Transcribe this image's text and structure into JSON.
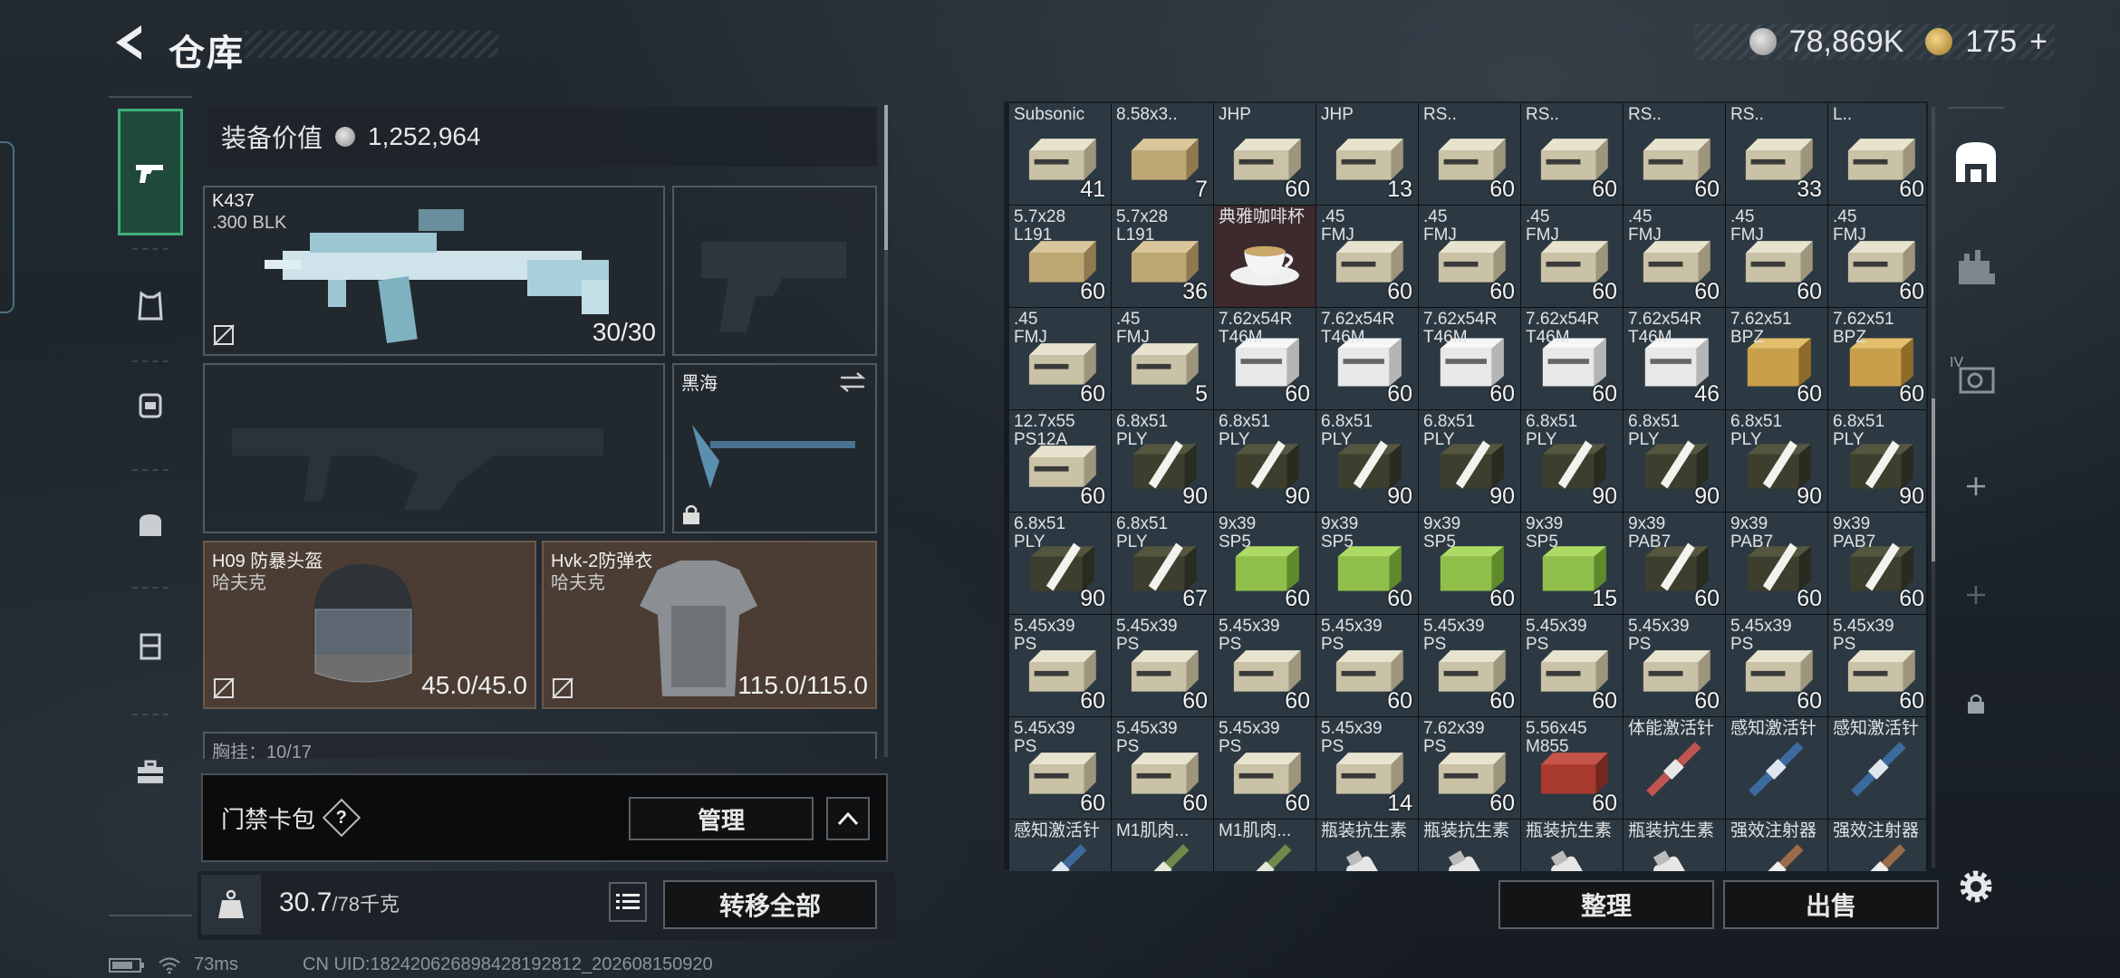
{
  "header": {
    "title": "仓库"
  },
  "currency": {
    "silver": "78,869K",
    "gold": "175",
    "gold_plus": "+"
  },
  "equip_value": {
    "label": "装备价值",
    "value": "1,252,964"
  },
  "sidebar": {
    "items": [
      "pistol-icon",
      "armor-vest-icon",
      "backpack-icon",
      "chest-rig-icon",
      "case-icon",
      "toolbox-icon"
    ]
  },
  "slots": {
    "primary": {
      "name": "K437",
      "sub": ".300 BLK",
      "ammo": "30/30"
    },
    "melee": {
      "name": "黑海"
    },
    "helmet": {
      "name": "H09 防暴头盔",
      "sub": "哈夫克",
      "dur": "45.0/45.0"
    },
    "armor": {
      "name": "Hvk-2防弹衣",
      "sub": "哈夫克",
      "dur": "115.0/115.0"
    },
    "chest_partial": "胸挂：10/17"
  },
  "card": {
    "label": "门禁卡包",
    "help": "?",
    "manage": "管理"
  },
  "weight": {
    "current": "30.7",
    "max": "/78千克"
  },
  "transfer_all": "转移全部",
  "status": {
    "ping": "73ms",
    "uid": "CN UID:18242062689842819281​2_202608150920"
  },
  "buttons": {
    "sort": "整理",
    "sell": "出售"
  },
  "grid": [
    {
      "l1": "Subsonic",
      "l2": "",
      "count": "41",
      "art": "ammo-box"
    },
    {
      "l1": "8.58x3..",
      "l2": "",
      "count": "7",
      "art": "ammo-tan"
    },
    {
      "l1": "JHP",
      "l2": "",
      "count": "60",
      "art": "ammo-box"
    },
    {
      "l1": "JHP",
      "l2": "",
      "count": "13",
      "art": "ammo-box"
    },
    {
      "l1": "RS..",
      "l2": "",
      "count": "60",
      "art": "ammo-box"
    },
    {
      "l1": "RS..",
      "l2": "",
      "count": "60",
      "art": "ammo-box"
    },
    {
      "l1": "RS..",
      "l2": "",
      "count": "60",
      "art": "ammo-box"
    },
    {
      "l1": "RS..",
      "l2": "",
      "count": "33",
      "art": "ammo-box"
    },
    {
      "l1": "L..",
      "l2": "",
      "count": "60",
      "art": "ammo-box"
    },
    {
      "l1": "5.7x28",
      "l2": "L191",
      "count": "60",
      "art": "ammo-tan"
    },
    {
      "l1": "5.7x28",
      "l2": "L191",
      "count": "36",
      "art": "ammo-tan"
    },
    {
      "l1": "典雅咖啡杯",
      "l2": "",
      "count": "",
      "art": "teacup",
      "red": true
    },
    {
      "l1": ".45",
      "l2": "FMJ",
      "count": "60",
      "art": "ammo-box"
    },
    {
      "l1": ".45",
      "l2": "FMJ",
      "count": "60",
      "art": "ammo-box"
    },
    {
      "l1": ".45",
      "l2": "FMJ",
      "count": "60",
      "art": "ammo-box"
    },
    {
      "l1": ".45",
      "l2": "FMJ",
      "count": "60",
      "art": "ammo-box"
    },
    {
      "l1": ".45",
      "l2": "FMJ",
      "count": "60",
      "art": "ammo-box"
    },
    {
      "l1": ".45",
      "l2": "FMJ",
      "count": "60",
      "art": "ammo-box"
    },
    {
      "l1": ".45",
      "l2": "FMJ",
      "count": "60",
      "art": "ammo-box"
    },
    {
      "l1": ".45",
      "l2": "FMJ",
      "count": "5",
      "art": "ammo-box"
    },
    {
      "l1": "7.62x54R",
      "l2": "T46M",
      "count": "60",
      "art": "ammo-white"
    },
    {
      "l1": "7.62x54R",
      "l2": "T46M",
      "count": "60",
      "art": "ammo-white"
    },
    {
      "l1": "7.62x54R",
      "l2": "T46M",
      "count": "60",
      "art": "ammo-white"
    },
    {
      "l1": "7.62x54R",
      "l2": "T46M",
      "count": "60",
      "art": "ammo-white"
    },
    {
      "l1": "7.62x54R",
      "l2": "T46M",
      "count": "46",
      "art": "ammo-white"
    },
    {
      "l1": "7.62x51",
      "l2": "BPZ",
      "count": "60",
      "art": "ammo-gold"
    },
    {
      "l1": "7.62x51",
      "l2": "BPZ",
      "count": "60",
      "art": "ammo-gold"
    },
    {
      "l1": "12.7x55",
      "l2": "PS12A",
      "count": "60",
      "art": "ammo-box"
    },
    {
      "l1": "6.8x51",
      "l2": "PLY",
      "count": "90",
      "art": "ammo-dark"
    },
    {
      "l1": "6.8x51",
      "l2": "PLY",
      "count": "90",
      "art": "ammo-dark"
    },
    {
      "l1": "6.8x51",
      "l2": "PLY",
      "count": "90",
      "art": "ammo-dark"
    },
    {
      "l1": "6.8x51",
      "l2": "PLY",
      "count": "90",
      "art": "ammo-dark"
    },
    {
      "l1": "6.8x51",
      "l2": "PLY",
      "count": "90",
      "art": "ammo-dark"
    },
    {
      "l1": "6.8x51",
      "l2": "PLY",
      "count": "90",
      "art": "ammo-dark"
    },
    {
      "l1": "6.8x51",
      "l2": "PLY",
      "count": "90",
      "art": "ammo-dark"
    },
    {
      "l1": "6.8x51",
      "l2": "PLY",
      "count": "90",
      "art": "ammo-dark"
    },
    {
      "l1": "6.8x51",
      "l2": "PLY",
      "count": "90",
      "art": "ammo-dark"
    },
    {
      "l1": "6.8x51",
      "l2": "PLY",
      "count": "67",
      "art": "ammo-dark"
    },
    {
      "l1": "9x39",
      "l2": "SP5",
      "count": "60",
      "art": "ammo-green"
    },
    {
      "l1": "9x39",
      "l2": "SP5",
      "count": "60",
      "art": "ammo-green"
    },
    {
      "l1": "9x39",
      "l2": "SP5",
      "count": "60",
      "art": "ammo-green"
    },
    {
      "l1": "9x39",
      "l2": "SP5",
      "count": "15",
      "art": "ammo-green"
    },
    {
      "l1": "9x39",
      "l2": "PAB7",
      "count": "60",
      "art": "ammo-dark"
    },
    {
      "l1": "9x39",
      "l2": "PAB7",
      "count": "60",
      "art": "ammo-dark"
    },
    {
      "l1": "9x39",
      "l2": "PAB7",
      "count": "60",
      "art": "ammo-dark"
    },
    {
      "l1": "5.45x39",
      "l2": "PS",
      "count": "60",
      "art": "ammo-box"
    },
    {
      "l1": "5.45x39",
      "l2": "PS",
      "count": "60",
      "art": "ammo-box"
    },
    {
      "l1": "5.45x39",
      "l2": "PS",
      "count": "60",
      "art": "ammo-box"
    },
    {
      "l1": "5.45x39",
      "l2": "PS",
      "count": "60",
      "art": "ammo-box"
    },
    {
      "l1": "5.45x39",
      "l2": "PS",
      "count": "60",
      "art": "ammo-box"
    },
    {
      "l1": "5.45x39",
      "l2": "PS",
      "count": "60",
      "art": "ammo-box"
    },
    {
      "l1": "5.45x39",
      "l2": "PS",
      "count": "60",
      "art": "ammo-box"
    },
    {
      "l1": "5.45x39",
      "l2": "PS",
      "count": "60",
      "art": "ammo-box"
    },
    {
      "l1": "5.45x39",
      "l2": "PS",
      "count": "60",
      "art": "ammo-box"
    },
    {
      "l1": "5.45x39",
      "l2": "PS",
      "count": "60",
      "art": "ammo-box"
    },
    {
      "l1": "5.45x39",
      "l2": "PS",
      "count": "60",
      "art": "ammo-box"
    },
    {
      "l1": "5.45x39",
      "l2": "PS",
      "count": "60",
      "art": "ammo-box"
    },
    {
      "l1": "5.45x39",
      "l2": "PS",
      "count": "14",
      "art": "ammo-box"
    },
    {
      "l1": "7.62x39",
      "l2": "PS",
      "count": "60",
      "art": "ammo-box"
    },
    {
      "l1": "5.56x45",
      "l2": "M855",
      "count": "60",
      "art": "ammo-red"
    },
    {
      "l1": "体能激活针",
      "l2": "",
      "count": "",
      "art": "syringe-red"
    },
    {
      "l1": "感知激活针",
      "l2": "",
      "count": "",
      "art": "syringe-blue"
    },
    {
      "l1": "感知激活针",
      "l2": "",
      "count": "",
      "art": "syringe-blue"
    },
    {
      "l1": "感知激活针",
      "l2": "",
      "count": "",
      "art": "syringe-blue"
    },
    {
      "l1": "M1肌肉...",
      "l2": "",
      "count": "",
      "art": "syringe-green"
    },
    {
      "l1": "M1肌肉...",
      "l2": "",
      "count": "",
      "art": "syringe-green"
    },
    {
      "l1": "瓶装抗生素",
      "l2": "",
      "count": "",
      "art": "bottle"
    },
    {
      "l1": "瓶装抗生素",
      "l2": "",
      "count": "",
      "art": "bottle"
    },
    {
      "l1": "瓶装抗生素",
      "l2": "",
      "count": "",
      "art": "bottle"
    },
    {
      "l1": "瓶装抗生素",
      "l2": "",
      "count": "",
      "art": "bottle"
    },
    {
      "l1": "强效注射器",
      "l2": "",
      "count": "",
      "art": "syringe-brown"
    },
    {
      "l1": "强效注射器",
      "l2": "",
      "count": "",
      "art": "syringe-brown"
    }
  ],
  "right_column": {
    "level_label": "IV"
  }
}
